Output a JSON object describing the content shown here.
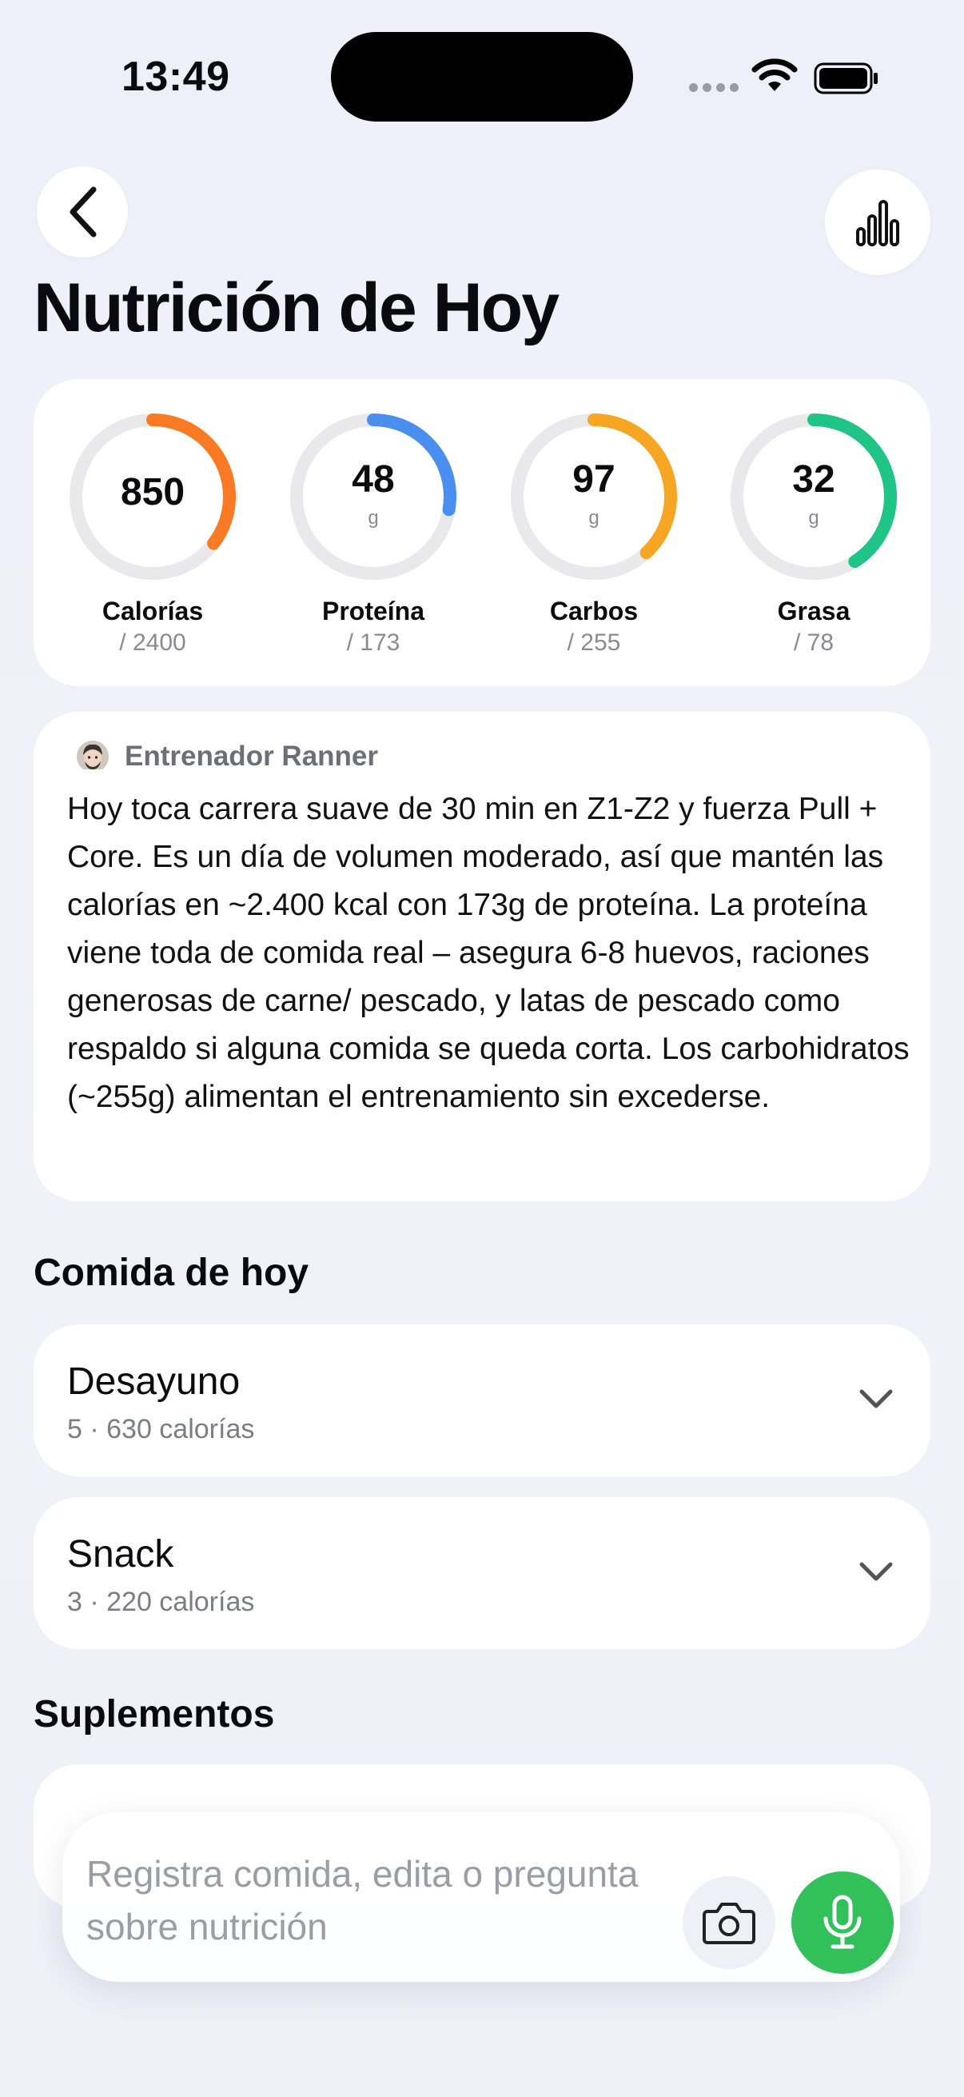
{
  "status_bar": {
    "time": "13:49"
  },
  "header": {
    "title": "Nutrición de Hoy"
  },
  "macros": [
    {
      "value": "850",
      "unit": "",
      "name": "Calorías",
      "goal": "/ 2400",
      "color": "#f97a22",
      "progress": 0.354
    },
    {
      "value": "48",
      "unit": "g",
      "name": "Proteína",
      "goal": "/ 173",
      "color": "#4a8ff0",
      "progress": 0.277
    },
    {
      "value": "97",
      "unit": "g",
      "name": "Carbos",
      "goal": "/ 255",
      "color": "#f6a623",
      "progress": 0.38
    },
    {
      "value": "32",
      "unit": "g",
      "name": "Grasa",
      "goal": "/ 78",
      "color": "#1fc487",
      "progress": 0.41
    }
  ],
  "coach": {
    "name": "Entrenador Ranner",
    "message": "Hoy toca carrera suave de 30 min en Z1-Z2 y fuerza Pull + Core. Es un día de volumen moderado, así que mantén las calorías en ~2.400 kcal con 173g de proteína. La proteína viene toda de comida real – asegura 6-8 huevos, raciones generosas de carne/ pescado, y latas de pescado como respaldo si alguna comida se queda corta. Los carbohidratos (~255g) alimentan el entrenamiento sin excederse."
  },
  "meals_section": {
    "title": "Comida de hoy",
    "items": [
      {
        "name": "Desayuno",
        "summary": "5 · 630 calorías"
      },
      {
        "name": "Snack",
        "summary": "3 · 220 calorías"
      }
    ]
  },
  "supplements_section": {
    "title": "Suplementos"
  },
  "composer": {
    "placeholder": "Registra comida, edita o pregunta sobre nutrición"
  },
  "icons": {
    "back": "chevron-left-icon",
    "stats": "bar-chart-icon",
    "camera": "camera-icon",
    "mic": "microphone-icon"
  }
}
